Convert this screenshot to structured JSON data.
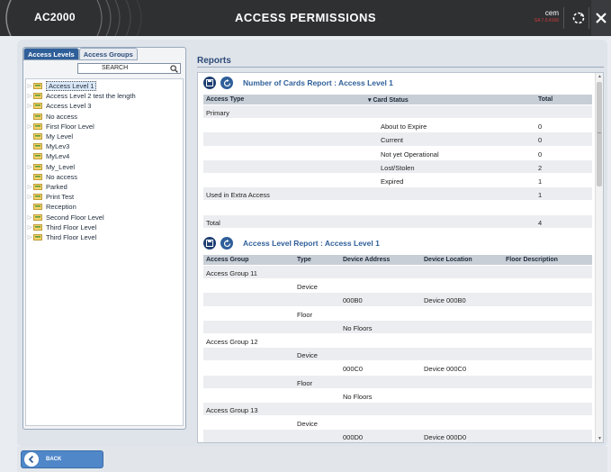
{
  "header": {
    "app_name": "AC2000",
    "title": "ACCESS PERMISSIONS",
    "cem_name": "cem",
    "cem_version": "SA 7.0.4166",
    "close_label": "✕"
  },
  "left_panel": {
    "tabs": [
      "Access Levels",
      "Access Groups"
    ],
    "search_value": "SEARCH",
    "tree_items": [
      {
        "label": "Access Level 1",
        "expandable": true
      },
      {
        "label": "Access Level 2 test the length",
        "expandable": true
      },
      {
        "label": "Access Level 3",
        "expandable": true
      },
      {
        "label": "No access",
        "expandable": false
      },
      {
        "label": "First Floor Level",
        "expandable": true
      },
      {
        "label": "My Level",
        "expandable": false
      },
      {
        "label": "MyLev3",
        "expandable": false
      },
      {
        "label": "MyLev4",
        "expandable": false
      },
      {
        "label": "My_Level",
        "expandable": true
      },
      {
        "label": "No access",
        "expandable": false
      },
      {
        "label": "Parked",
        "expandable": true
      },
      {
        "label": "Print Test",
        "expandable": true
      },
      {
        "label": "Reception",
        "expandable": false
      },
      {
        "label": "Second Floor Level",
        "expandable": true
      },
      {
        "label": "Third Floor Level",
        "expandable": true
      },
      {
        "label": "Third Floor Level",
        "expandable": true
      }
    ]
  },
  "reports": {
    "label": "Reports",
    "cards_report": {
      "title": "Number of Cards Report : Access Level 1",
      "columns": [
        "Access Type",
        "▾ Card Status",
        "Total"
      ],
      "rows": [
        [
          "Primary",
          "",
          ""
        ],
        [
          "",
          "About to Expire",
          "0"
        ],
        [
          "",
          "Current",
          "0"
        ],
        [
          "",
          "Not yet Operational",
          "0"
        ],
        [
          "",
          "Lost/Stolen",
          "2"
        ],
        [
          "",
          "Expired",
          "1"
        ],
        [
          "Used in Extra Access",
          "",
          "1"
        ],
        [
          "",
          "",
          ""
        ],
        [
          "Total",
          "",
          "4"
        ]
      ]
    },
    "level_report": {
      "title": "Access Level Report : Access Level 1",
      "columns": [
        "Access Group",
        "Type",
        "Device Address",
        "Device Location",
        "Floor Description"
      ],
      "rows": [
        [
          "Access Group 11",
          "",
          "",
          "",
          ""
        ],
        [
          "",
          "Device",
          "",
          "",
          ""
        ],
        [
          "",
          "",
          "000B0",
          "Device 000B0",
          ""
        ],
        [
          "",
          "Floor",
          "",
          "",
          ""
        ],
        [
          "",
          "",
          "No Floors",
          "",
          ""
        ],
        [
          "Access Group 12",
          "",
          "",
          "",
          ""
        ],
        [
          "",
          "Device",
          "",
          "",
          ""
        ],
        [
          "",
          "",
          "000C0",
          "Device 000C0",
          ""
        ],
        [
          "",
          "Floor",
          "",
          "",
          ""
        ],
        [
          "",
          "",
          "No Floors",
          "",
          ""
        ],
        [
          "Access Group 13",
          "",
          "",
          "",
          ""
        ],
        [
          "",
          "Device",
          "",
          "",
          ""
        ],
        [
          "",
          "",
          "000D0",
          "Device 000D0",
          ""
        ]
      ]
    }
  },
  "footer": {
    "back_label": "BACK"
  },
  "colors": {
    "header_bg": "#2f3032",
    "accent": "#2f5f99",
    "button": "#4f87c9"
  }
}
